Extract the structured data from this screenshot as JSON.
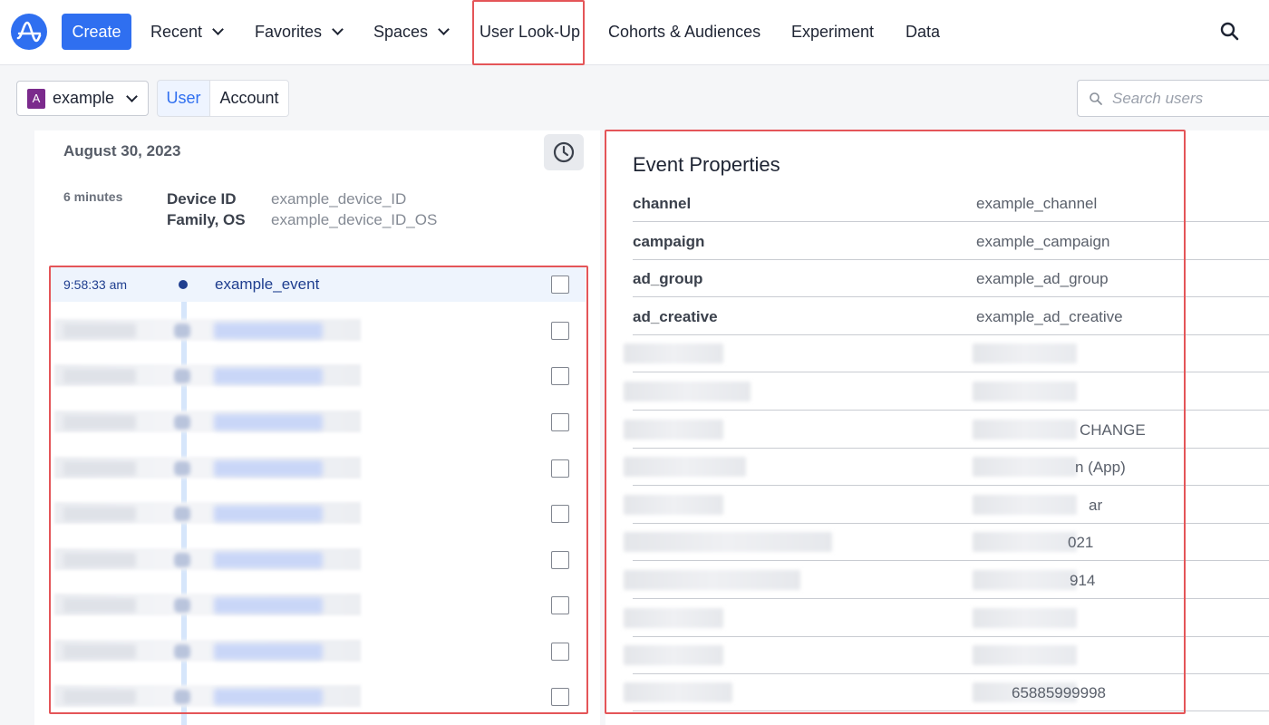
{
  "nav": {
    "create_label": "Create",
    "items": [
      {
        "label": "Recent",
        "dropdown": true
      },
      {
        "label": "Favorites",
        "dropdown": true
      },
      {
        "label": "Spaces",
        "dropdown": true
      },
      {
        "label": "User Look-Up",
        "dropdown": false
      },
      {
        "label": "Cohorts & Audiences",
        "dropdown": false
      },
      {
        "label": "Experiment",
        "dropdown": false
      },
      {
        "label": "Data",
        "dropdown": false
      }
    ]
  },
  "toolbar": {
    "project_badge": "A",
    "project_name": "example",
    "tab_user": "User",
    "tab_account": "Account",
    "search_placeholder": "Search users"
  },
  "session": {
    "date": "August 30, 2023",
    "duration": "6 minutes",
    "device_label_line1": "Device ID",
    "device_label_line2": "Family, OS",
    "device_value_line1": "example_device_ID",
    "device_value_line2": "example_device_ID_OS"
  },
  "events": {
    "first": {
      "time": "9:58:33 am",
      "name": "example_event"
    }
  },
  "event_properties": {
    "title": "Event Properties",
    "rows": [
      {
        "key": "channel",
        "value": "example_channel"
      },
      {
        "key": "campaign",
        "value": "example_campaign"
      },
      {
        "key": "ad_group",
        "value": "example_ad_group"
      },
      {
        "key": "ad_creative",
        "value": "example_ad_creative"
      }
    ],
    "blurred_value_tails": [
      "CHANGE",
      "n (App)",
      "ar",
      "021",
      "914",
      "65885999998"
    ]
  },
  "colors": {
    "accent": "#2f6ff0",
    "highlight_box": "#e45558",
    "event_text": "#1f3e8f",
    "project_badge": "#7b2a8c"
  }
}
